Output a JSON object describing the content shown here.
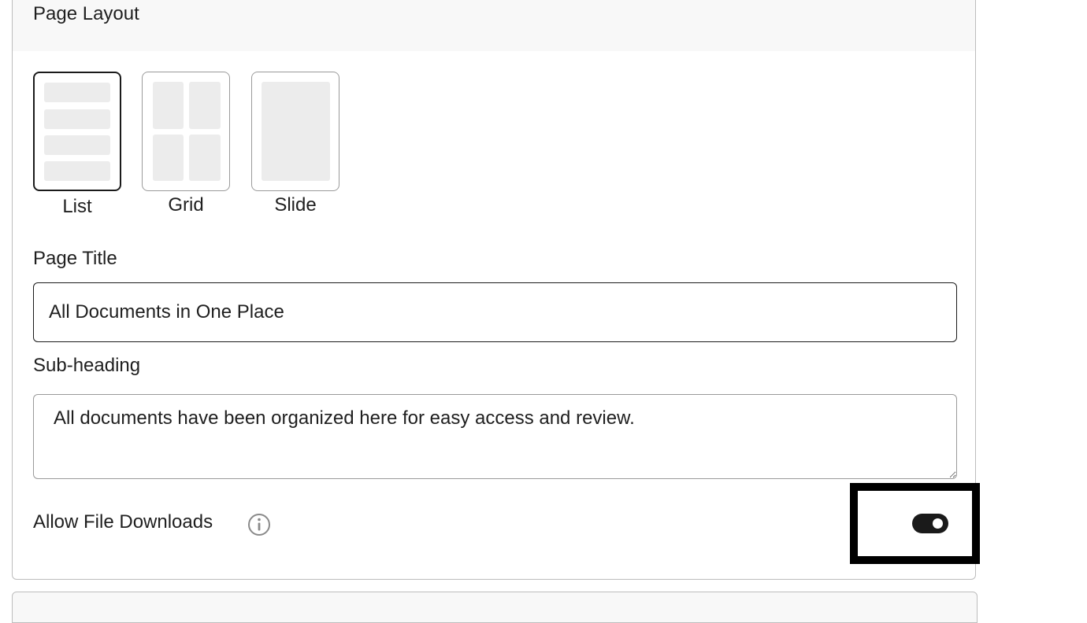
{
  "panel": {
    "title": "Page Layout"
  },
  "layout_options": [
    {
      "label": "List",
      "selected": true
    },
    {
      "label": "Grid",
      "selected": false
    },
    {
      "label": "Slide",
      "selected": false
    }
  ],
  "page_title": {
    "label": "Page Title",
    "value": "All Documents in One Place"
  },
  "sub_heading": {
    "label": "Sub-heading",
    "value": "All documents have been organized here for easy access and review."
  },
  "downloads": {
    "label": "Allow File Downloads",
    "enabled": true,
    "info_icon": "info-icon"
  },
  "colors": {
    "accent": "#1a1a1a",
    "header_bg": "#f8f8f8",
    "placeholder_bar": "#ececec",
    "highlight_box": "#000000"
  }
}
